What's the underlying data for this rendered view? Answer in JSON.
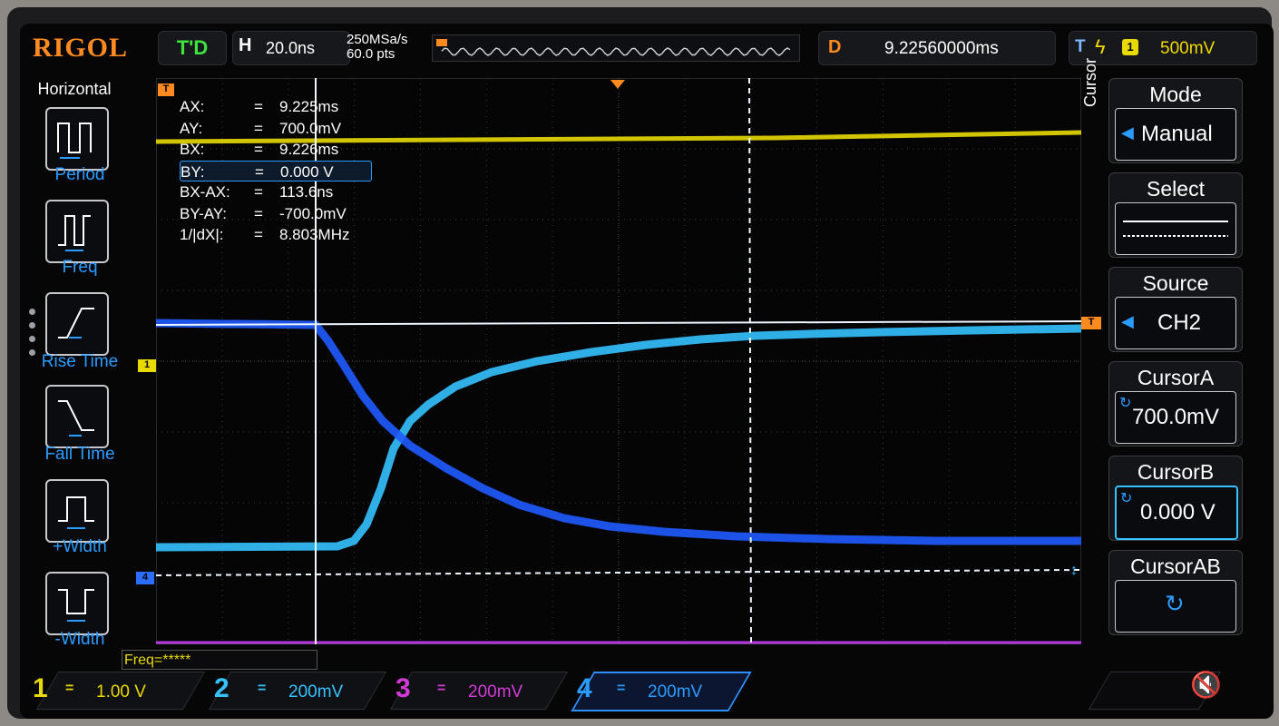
{
  "brand": "RIGOL",
  "status": "T'D",
  "horizontal": {
    "label": "H",
    "timebase": "20.0ns",
    "sample_rate": "250MSa/s",
    "points": "60.0 pts"
  },
  "delay": {
    "label": "D",
    "value": "9.22560000ms"
  },
  "trigger": {
    "label": "T",
    "source": "1",
    "level": "500mV"
  },
  "left_menu": {
    "title": "Horizontal",
    "items": [
      {
        "label": "Period",
        "icon": "period-icon"
      },
      {
        "label": "Freq",
        "icon": "freq-icon"
      },
      {
        "label": "Rise Time",
        "icon": "rise-time-icon"
      },
      {
        "label": "Fall Time",
        "icon": "fall-time-icon"
      },
      {
        "label": "+Width",
        "icon": "pos-width-icon"
      },
      {
        "label": "-Width",
        "icon": "neg-width-icon"
      }
    ]
  },
  "readout": [
    {
      "key": "AX:",
      "eq": "=",
      "value": "9.225ms"
    },
    {
      "key": "AY:",
      "eq": "=",
      "value": "700.0mV"
    },
    {
      "key": "BX:",
      "eq": "=",
      "value": "9.226ms"
    },
    {
      "key": "BY:",
      "eq": "=",
      "value": "0.000 V",
      "selected": true
    },
    {
      "key": "BX-AX:",
      "eq": "=",
      "value": "113.6ns"
    },
    {
      "key": "BY-AY:",
      "eq": "=",
      "value": "-700.0mV"
    },
    {
      "key": "1/|dX|:",
      "eq": "=",
      "value": "8.803MHz"
    }
  ],
  "right_menu": {
    "side_label": "Cursor",
    "mode": {
      "title": "Mode",
      "value": "Manual"
    },
    "select": {
      "title": "Select"
    },
    "source": {
      "title": "Source",
      "value": "CH2"
    },
    "cursor_a": {
      "title": "CursorA",
      "value": "700.0mV"
    },
    "cursor_b": {
      "title": "CursorB",
      "value": "0.000 V"
    },
    "cursor_ab": {
      "title": "CursorAB"
    }
  },
  "freq_counter": "Freq=*****",
  "channels": [
    {
      "num": "1",
      "eq": "=",
      "scale": "1.00 V",
      "color": "#e8d900"
    },
    {
      "num": "2",
      "eq": "=",
      "scale": "200mV",
      "color": "#35c2ff"
    },
    {
      "num": "3",
      "eq": "=",
      "scale": "200mV",
      "color": "#d23ad8"
    },
    {
      "num": "4",
      "eq": "=",
      "scale": "200mV",
      "color": "#2b6dff"
    }
  ],
  "markers": {
    "ch1": "1",
    "ch4": "4",
    "trig": "T",
    "left_top": "T"
  },
  "colors": {
    "ch1": "#e8d900",
    "ch2": "#35c2ff",
    "ch3": "#d23ad8",
    "ch4": "#2b6dff",
    "accent": "#ff8a1f",
    "menu_text": "#2b9cff"
  }
}
